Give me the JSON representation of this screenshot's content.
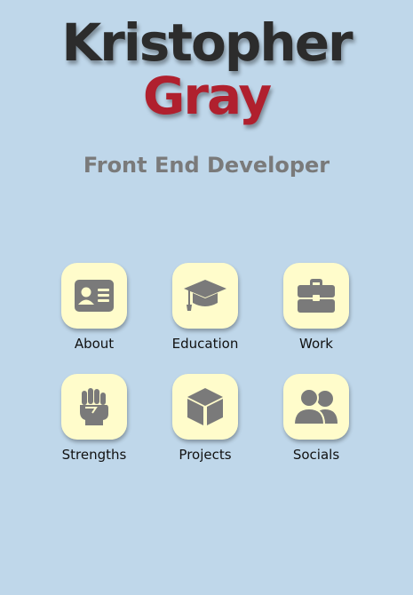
{
  "header": {
    "first_name": "Kristopher",
    "last_name": "Gray",
    "subtitle": "Front End Developer"
  },
  "nav": {
    "items": [
      {
        "label": "About",
        "icon": "id-card-icon"
      },
      {
        "label": "Education",
        "icon": "graduation-cap-icon"
      },
      {
        "label": "Work",
        "icon": "briefcase-icon"
      },
      {
        "label": "Strengths",
        "icon": "fist-icon"
      },
      {
        "label": "Projects",
        "icon": "cube-icon"
      },
      {
        "label": "Socials",
        "icon": "users-icon"
      }
    ]
  },
  "colors": {
    "background": "#bfd7ea",
    "first_name": "#2c2c2c",
    "last_name": "#b0202e",
    "subtitle": "#7a7a7a",
    "tile": "#fffccb",
    "icon": "#7a7a7a"
  }
}
